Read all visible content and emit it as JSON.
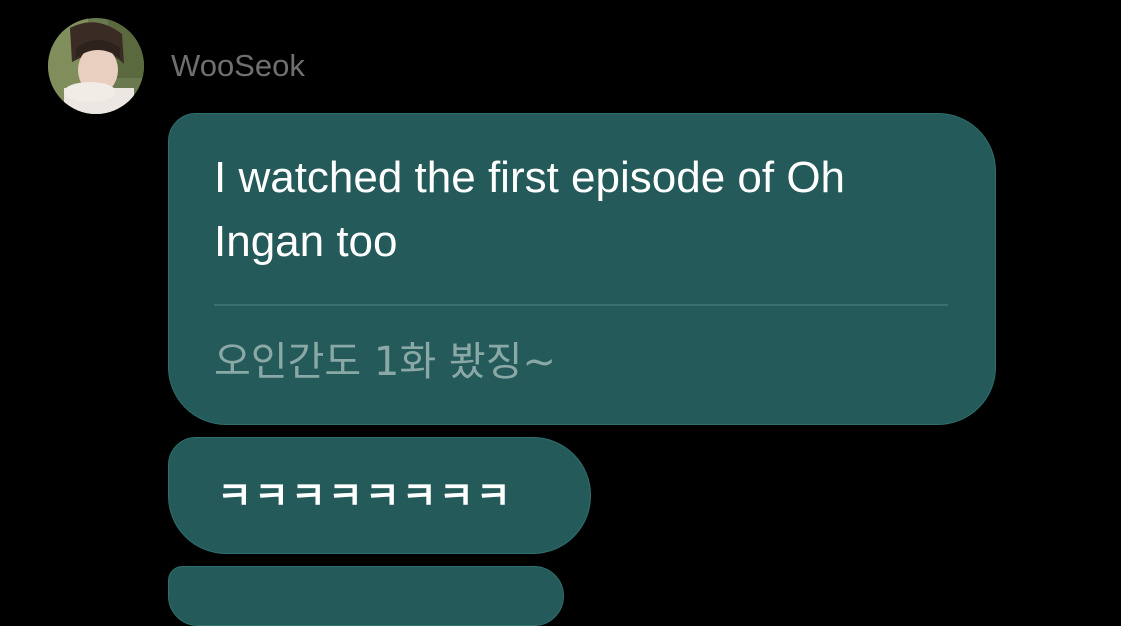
{
  "chat": {
    "sender": {
      "name": "WooSeok",
      "avatar_icon": "profile-photo"
    },
    "messages": [
      {
        "text": "I watched the first episode of Oh Ingan too",
        "translation": "오인간도 1화 봤징~"
      },
      {
        "text": "ㅋㅋㅋㅋㅋㅋㅋㅋ"
      },
      {
        "text": ""
      }
    ]
  },
  "colors": {
    "background": "#000000",
    "bubble": "#245a59",
    "bubble_border": "#2f6f6d",
    "sender_name": "#6f6f6f",
    "translation_text": "#8aa8a6",
    "message_text": "#ffffff"
  }
}
